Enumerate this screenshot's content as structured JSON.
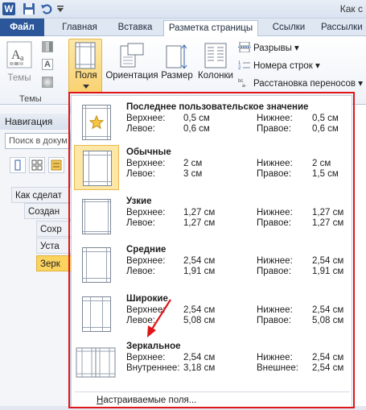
{
  "window": {
    "title": "Как с"
  },
  "tabs": {
    "file": "Файл",
    "home": "Главная",
    "insert": "Вставка",
    "layout": "Разметка страницы",
    "refs": "Ссылки",
    "mail": "Рассылки"
  },
  "ribbon": {
    "themes": "Темы",
    "themes_group": "Темы",
    "margins": "Поля",
    "orientation": "Ориентация",
    "size": "Размер",
    "columns": "Колонки",
    "breaks": "Разрывы ▾",
    "line_numbers": "Номера строк ▾",
    "hyphenation": "Расстановка переносов ▾"
  },
  "navigation": {
    "title": "Навигация",
    "search_placeholder": "Поиск в докум",
    "items": [
      "Как сделат",
      "Создан",
      "Сохр",
      "Уста",
      "Зерк"
    ]
  },
  "margins": {
    "options": [
      {
        "name": "Последнее пользовательское значение",
        "top_label": "Верхнее:",
        "top": "0,5 см",
        "left_label": "Левое:",
        "left": "0,6 см",
        "bottom_label": "Нижнее:",
        "bottom": "0,5 см",
        "right_label": "Правое:",
        "right": "0,6 см"
      },
      {
        "name": "Обычные",
        "top_label": "Верхнее:",
        "top": "2 см",
        "left_label": "Левое:",
        "left": "3 см",
        "bottom_label": "Нижнее:",
        "bottom": "2 см",
        "right_label": "Правое:",
        "right": "1,5 см"
      },
      {
        "name": "Узкие",
        "top_label": "Верхнее:",
        "top": "1,27 см",
        "left_label": "Левое:",
        "left": "1,27 см",
        "bottom_label": "Нижнее:",
        "bottom": "1,27 см",
        "right_label": "Правое:",
        "right": "1,27 см"
      },
      {
        "name": "Средние",
        "top_label": "Верхнее:",
        "top": "2,54 см",
        "left_label": "Левое:",
        "left": "1,91 см",
        "bottom_label": "Нижнее:",
        "bottom": "2,54 см",
        "right_label": "Правое:",
        "right": "1,91 см"
      },
      {
        "name": "Широкие",
        "top_label": "Верхнее:",
        "top": "2,54 см",
        "left_label": "Левое:",
        "left": "5,08 см",
        "bottom_label": "Нижнее:",
        "bottom": "2,54 см",
        "right_label": "Правое:",
        "right": "5,08 см"
      },
      {
        "name": "Зеркальное",
        "top_label": "Верхнее:",
        "top": "2,54 см",
        "left_label": "Внутреннее:",
        "left": "3,18 см",
        "bottom_label": "Нижнее:",
        "bottom": "2,54 см",
        "right_label": "Внешнее:",
        "right": "2,54 см"
      }
    ],
    "custom_prefix": "Н",
    "custom_rest": "астраиваемые поля..."
  },
  "colors": {
    "accent": "#2b579a",
    "highlight": "#fbd35f",
    "annotation": "#e0151a"
  }
}
